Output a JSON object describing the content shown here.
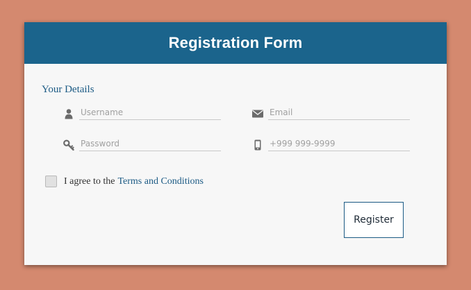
{
  "form": {
    "title": "Registration Form",
    "section_title": "Your Details",
    "fields": {
      "username": {
        "placeholder": "Username",
        "value": "",
        "icon": "user-icon"
      },
      "email": {
        "placeholder": "Email",
        "value": "",
        "icon": "envelope-icon"
      },
      "password": {
        "placeholder": "Password",
        "value": "",
        "icon": "key-icon"
      },
      "phone": {
        "placeholder": "+999 999-9999",
        "value": "",
        "icon": "mobile-phone-icon"
      }
    },
    "agree": {
      "text": "I agree to the",
      "link": "Terms and Conditions",
      "checked": false
    },
    "register_label": "Register"
  },
  "colors": {
    "background": "#d4896f",
    "header": "#1b648c",
    "accent": "#1b5a84",
    "card": "#f7f7f7"
  }
}
